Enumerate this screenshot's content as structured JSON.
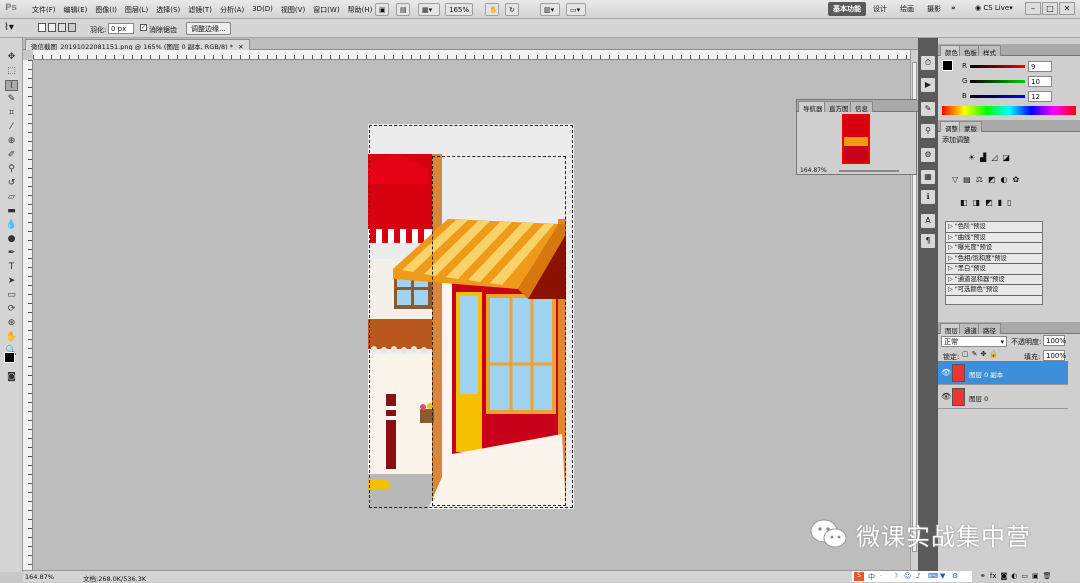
{
  "app": {
    "logo": "Ps",
    "menus": [
      "文件(F)",
      "编辑(E)",
      "图像(I)",
      "图层(L)",
      "选择(S)",
      "滤镜(T)",
      "分析(A)",
      "3D(D)",
      "视图(V)",
      "窗口(W)",
      "帮助(H)"
    ],
    "zoom_display": "165%",
    "workspaces": [
      "基本功能",
      "设计",
      "绘画",
      "摄影"
    ],
    "more": "»",
    "cs_live": "CS Live",
    "window_buttons": [
      "–",
      "□",
      "✕"
    ]
  },
  "options": {
    "feather_label": "羽化:",
    "feather_value": "0 px",
    "antialias_label": "消除锯齿",
    "refine_button": "调整边缘..."
  },
  "document": {
    "tab_title": "微信截图_20191022081151.png @ 165% (图层 0 副本, RGB/8) *",
    "tab_close": "✕"
  },
  "status": {
    "zoom": "164.87%",
    "doc_info": "文档:268.0K/536.3K"
  },
  "color_panel": {
    "tabs": [
      "颜色",
      "色板",
      "样式"
    ],
    "r_label": "R",
    "r_value": "9",
    "g_label": "G",
    "g_value": "10",
    "b_label": "B",
    "b_value": "12"
  },
  "navigator": {
    "tabs": [
      "导航器",
      "直方图",
      "信息"
    ],
    "zoom": "164.87%"
  },
  "adjust_panel": {
    "tabs": [
      "调整",
      "蒙版"
    ],
    "heading": "添加调整",
    "presets": [
      "\"色阶\"预设",
      "\"曲线\"预设",
      "\"曝光度\"预设",
      "\"色相/饱和度\"预设",
      "\"黑白\"预设",
      "\"通道混和器\"预设",
      "\"可选颜色\"预设"
    ]
  },
  "layers_panel": {
    "tabs": [
      "图层",
      "通道",
      "路径"
    ],
    "blend_mode": "正常",
    "opacity_label": "不透明度:",
    "opacity_value": "100%",
    "lock_label": "锁定:",
    "fill_label": "填充:",
    "fill_value": "100%",
    "layers": [
      {
        "name": "图层 0 副本",
        "selected": true
      },
      {
        "name": "图层 0",
        "selected": false
      }
    ]
  },
  "watermark": {
    "text": "微课实战集中营"
  },
  "colors": {
    "selection": "#3d8fd9",
    "awning_orange": "#f09a1a",
    "awning_yellow": "#f7d36a",
    "wall_red": "#c8001a",
    "door_yellow": "#f5c000",
    "window_blue": "#9fd3ef"
  }
}
